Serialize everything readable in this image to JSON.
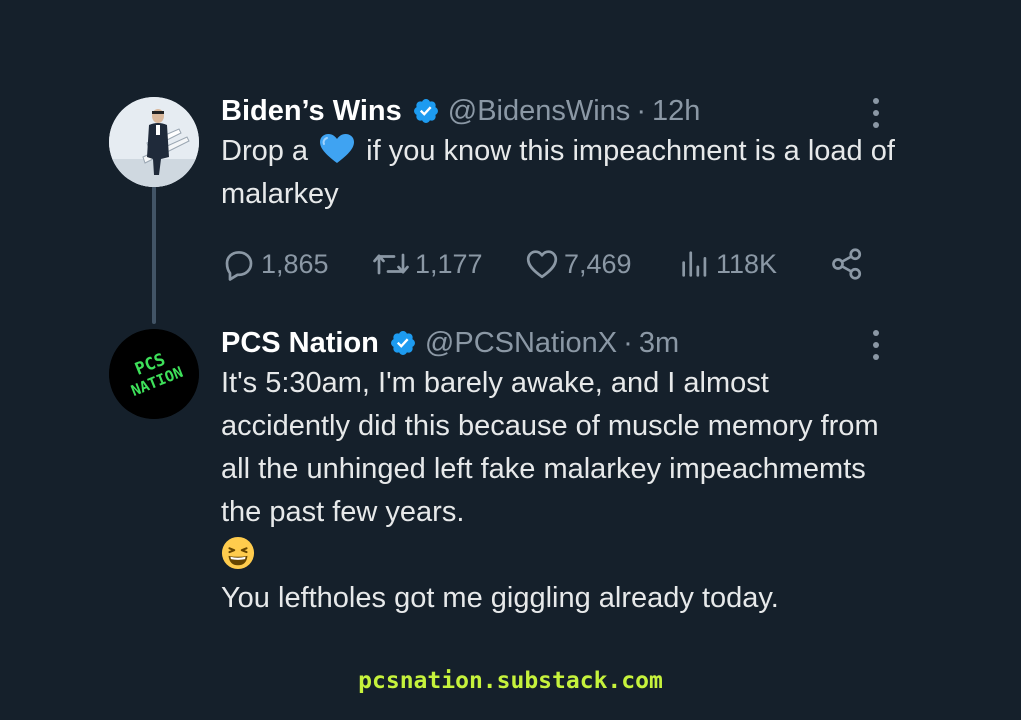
{
  "tweets": [
    {
      "display_name": "Biden’s Wins",
      "handle": "@BidensWins",
      "separator": "·",
      "time": "12h",
      "text_before_emoji": "Drop a",
      "emoji": "blue-heart",
      "text_after_emoji": "if you know this impeachment is a load of malarkey",
      "stats": {
        "replies": "1,865",
        "retweets": "1,177",
        "likes": "7,469",
        "views": "118K"
      }
    },
    {
      "display_name": "PCS Nation",
      "handle": "@PCSNationX",
      "separator": "·",
      "time": "3m",
      "avatar_text": "PCS NATION",
      "paragraph_1": "It's 5:30am, I'm barely awake, and I almost accidently did this because of muscle memory from all the unhinged left fake malarkey impeachmemts the past few years.",
      "emoji": "grinning-squinting-face",
      "paragraph_2": "You leftholes got me giggling already today."
    }
  ],
  "footer": {
    "text": "pcsnation.substack.com"
  },
  "colors": {
    "background": "#15202b",
    "secondary_text": "#8b98a5",
    "verified": "#1d9bf0",
    "thread_line": "#425466",
    "footer_text": "#c6f23c"
  }
}
